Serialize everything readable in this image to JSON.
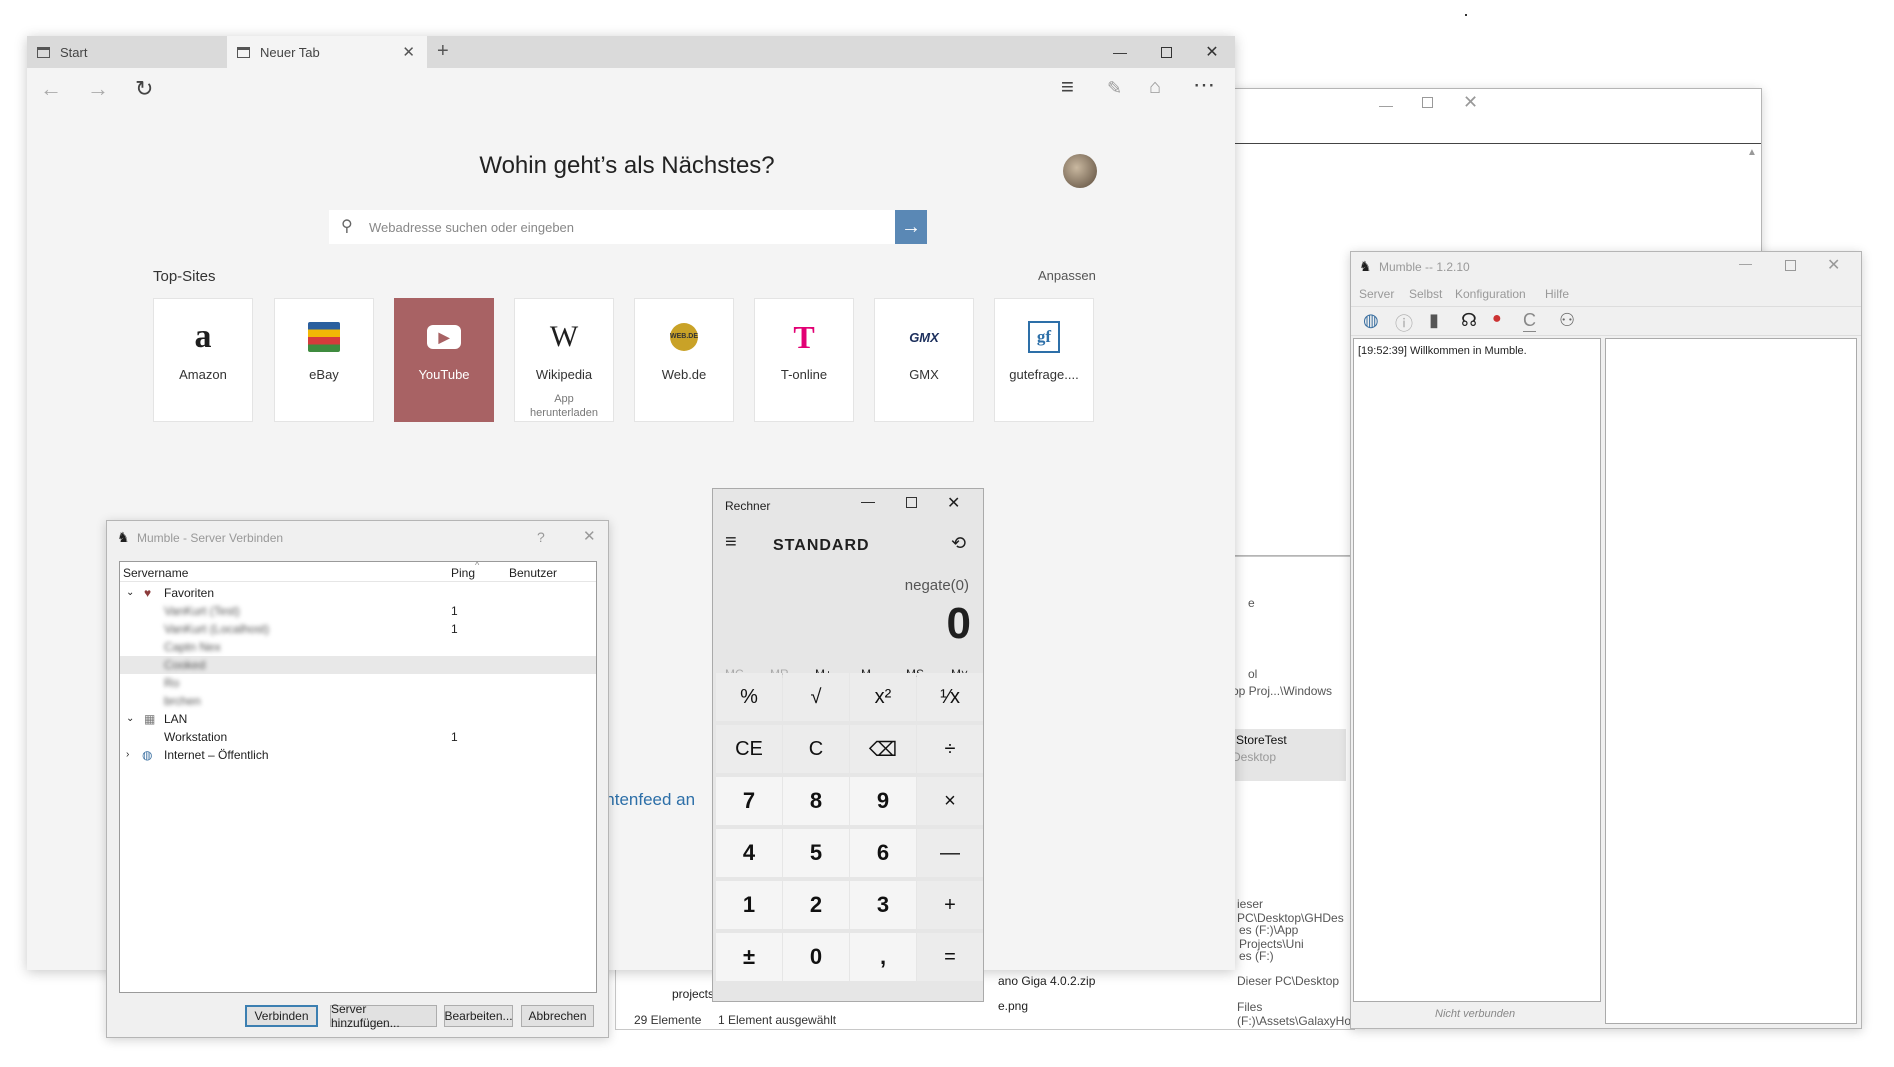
{
  "edge": {
    "tabs": [
      {
        "label": "Start"
      },
      {
        "label": "Neuer Tab"
      }
    ],
    "heading": "Wohin geht’s als Nächstes?",
    "search_placeholder": "Webadresse suchen oder eingeben",
    "topsites_label": "Top-Sites",
    "customize_label": "Anpassen",
    "feed_text": "ichtenfeed an",
    "sites": [
      {
        "name": "Amazon",
        "logo": "a"
      },
      {
        "name": "eBay",
        "logo": "bag"
      },
      {
        "name": "YouTube",
        "logo": "play"
      },
      {
        "name": "Wikipedia",
        "logo": "W",
        "sub": "App herunterladen"
      },
      {
        "name": "Web.de",
        "logo": "WEB.DE"
      },
      {
        "name": "T-online",
        "logo": "T"
      },
      {
        "name": "GMX",
        "logo": "GMX"
      },
      {
        "name": "gutefrage....",
        "logo": "gf"
      }
    ]
  },
  "mumble_dialog": {
    "title": "Mumble - Server Verbinden",
    "help": "?",
    "columns": {
      "name": "Servername",
      "ping": "Ping",
      "users": "Benutzer"
    },
    "favorites": "Favoriten",
    "fav_items": [
      {
        "name": "VanKurt (Test)",
        "ping": "1"
      },
      {
        "name": "VanKurt (Localhost)",
        "ping": "1"
      },
      {
        "name": "Captn Nex",
        "ping": ""
      },
      {
        "name": "Cooked",
        "ping": ""
      },
      {
        "name": "Ro",
        "ping": ""
      },
      {
        "name": "brchen",
        "ping": ""
      }
    ],
    "lan": "LAN",
    "lan_item": {
      "name": "Workstation",
      "ping": "1"
    },
    "internet": "Internet – Öffentlich",
    "buttons": {
      "connect": "Verbinden",
      "add": "Server hinzufügen...",
      "edit": "Bearbeiten...",
      "cancel": "Abbrechen"
    }
  },
  "calculator": {
    "title": "Rechner",
    "mode": "STANDARD",
    "expression": "negate(0)",
    "display": "0",
    "memory": [
      "MC",
      "MR",
      "M+",
      "M-",
      "MS",
      "M˅"
    ],
    "keys": [
      [
        "%",
        "√",
        "x²",
        "¹⁄x"
      ],
      [
        "CE",
        "C",
        "⌫",
        "÷"
      ],
      [
        "7",
        "8",
        "9",
        "×"
      ],
      [
        "4",
        "5",
        "6",
        "—"
      ],
      [
        "1",
        "2",
        "3",
        "+"
      ],
      [
        "±",
        "0",
        ",",
        "="
      ]
    ]
  },
  "mumble_main": {
    "title": "Mumble -- 1.2.10",
    "menu": [
      "Server",
      "Selbst",
      "Konfiguration",
      "Hilfe"
    ],
    "log": "[19:52:39] Willkommen in Mumble.",
    "status": "Nicht verbunden"
  },
  "explorer": {
    "status_count": "29 Elemente",
    "status_sel": "1 Element ausgewählt",
    "file1": "projects",
    "file2": "ano Giga 4.0.2.zip",
    "file3": "e.png",
    "right_bits": [
      "e",
      "ol",
      "op Proj...\\Windows",
      "StoreTest",
      "Desktop",
      "ieser PC\\Desktop\\GHDes",
      "es (F:)\\App Projects\\Uni",
      "es (F:)",
      "Dieser PC\\Desktop",
      "Files (F:)\\Assets\\GalaxyHop"
    ]
  },
  "colors": {
    "youtube_tile": "#a86264",
    "go_button": "#5a88b5",
    "tile_border": "#e4e4e4"
  }
}
